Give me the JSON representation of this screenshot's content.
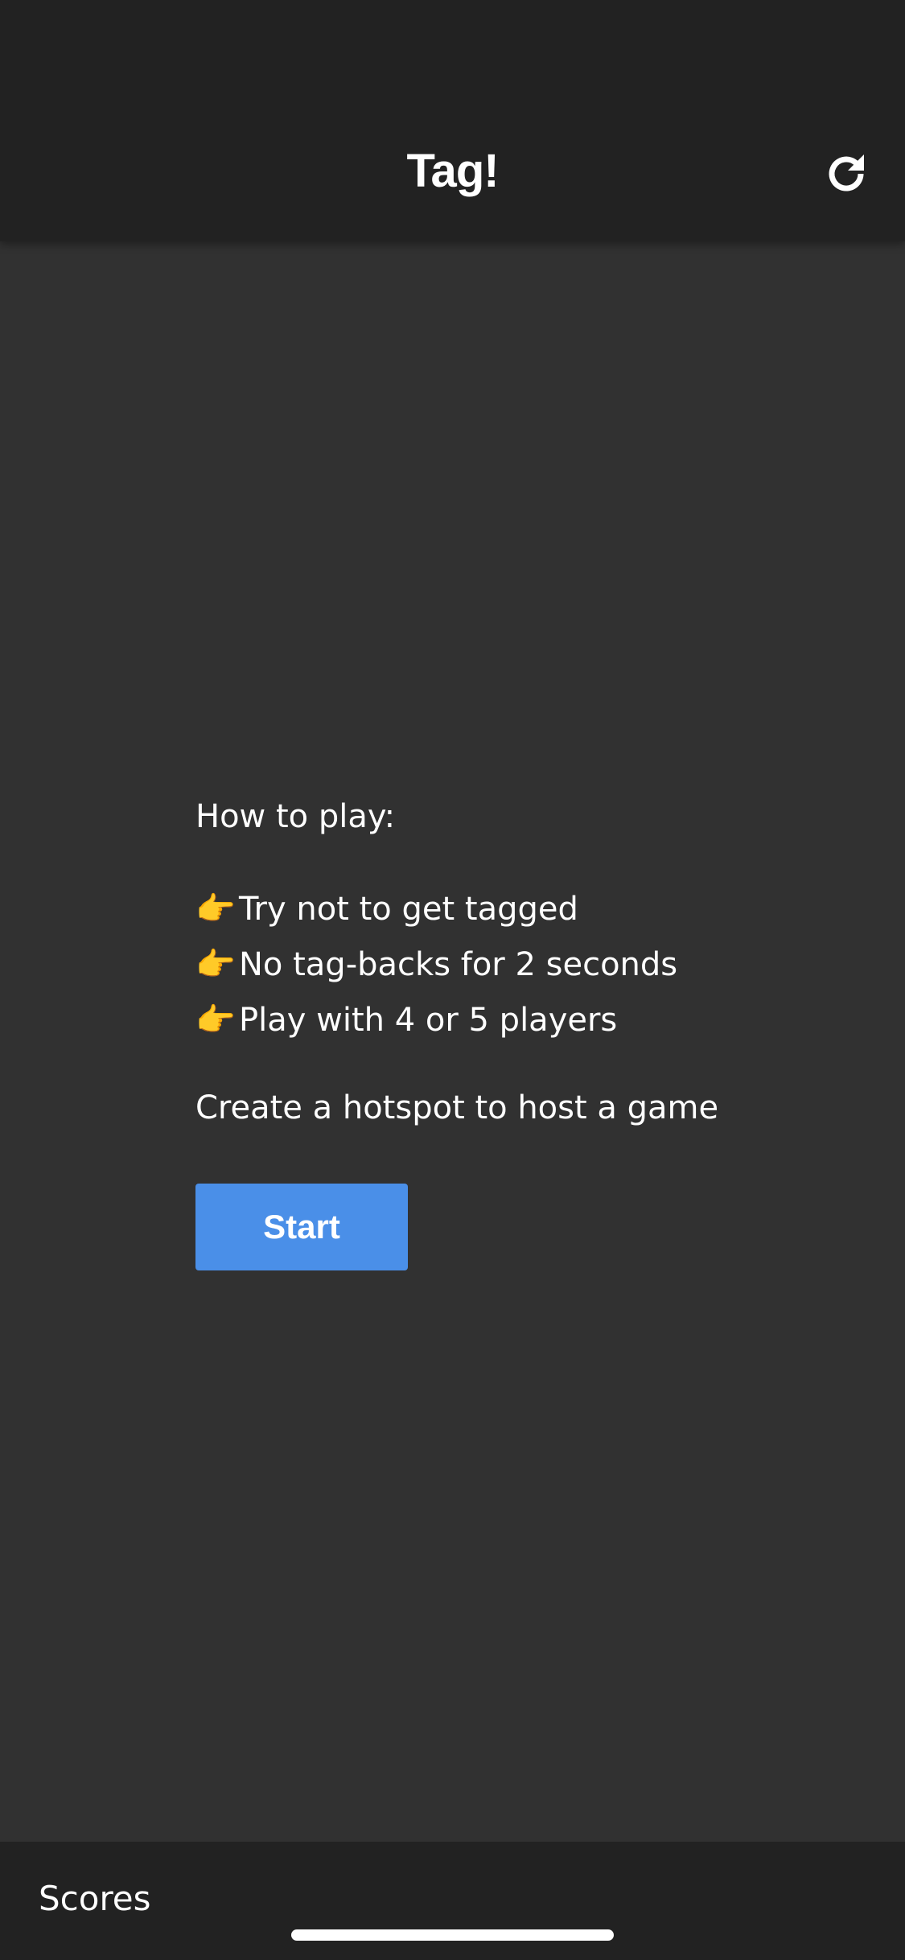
{
  "header": {
    "title": "Tag!",
    "refresh_icon": "refresh-icon"
  },
  "instructions": {
    "heading": "How to play:",
    "bullet_icon": "pointing-hand-icon",
    "bullet_glyph": "👉",
    "rules": [
      "Try not to get tagged",
      "No tag-backs for 2 seconds",
      "Play with 4 or 5 players"
    ],
    "hint": "Create a hotspot to host a game"
  },
  "actions": {
    "start_label": "Start"
  },
  "bottom_bar": {
    "scores_label": "Scores"
  },
  "colors": {
    "background": "#313131",
    "header": "#222222",
    "accent": "#4a8fe8",
    "text": "#ffffff"
  }
}
